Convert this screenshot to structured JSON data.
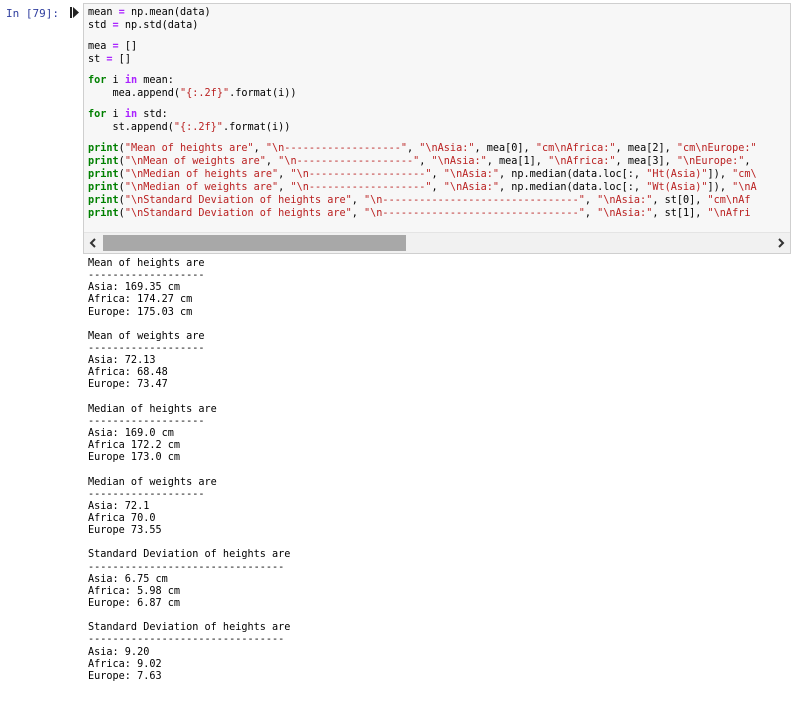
{
  "cell": {
    "prompt": "In [79]:",
    "code_lines": [
      [
        {
          "t": "mean "
        },
        {
          "t": "=",
          "c": "op"
        },
        {
          "t": " np.mean(data)"
        }
      ],
      [
        {
          "t": "std "
        },
        {
          "t": "=",
          "c": "op"
        },
        {
          "t": " np.std(data)"
        }
      ],
      [],
      [
        {
          "t": "mea "
        },
        {
          "t": "=",
          "c": "op"
        },
        {
          "t": " []"
        }
      ],
      [
        {
          "t": "st "
        },
        {
          "t": "=",
          "c": "op"
        },
        {
          "t": " []"
        }
      ],
      [],
      [
        {
          "t": "for",
          "c": "kw"
        },
        {
          "t": " i "
        },
        {
          "t": "in",
          "c": "op"
        },
        {
          "t": " mean:"
        }
      ],
      [
        {
          "t": "    mea.append("
        },
        {
          "t": "\"{:.2f}\"",
          "c": "str"
        },
        {
          "t": ".format(i))"
        }
      ],
      [],
      [
        {
          "t": "for",
          "c": "kw"
        },
        {
          "t": " i "
        },
        {
          "t": "in",
          "c": "op"
        },
        {
          "t": " std:"
        }
      ],
      [
        {
          "t": "    st.append("
        },
        {
          "t": "\"{:.2f}\"",
          "c": "str"
        },
        {
          "t": ".format(i))"
        }
      ],
      [],
      [
        {
          "t": "print",
          "c": "kw"
        },
        {
          "t": "("
        },
        {
          "t": "\"Mean of heights are\"",
          "c": "str"
        },
        {
          "t": ", "
        },
        {
          "t": "\"\\n-------------------\"",
          "c": "str"
        },
        {
          "t": ", "
        },
        {
          "t": "\"\\nAsia:\"",
          "c": "str"
        },
        {
          "t": ", mea[0], "
        },
        {
          "t": "\"cm\\nAfrica:\"",
          "c": "str"
        },
        {
          "t": ", mea[2], "
        },
        {
          "t": "\"cm\\nEurope:\"",
          "c": "str"
        }
      ],
      [
        {
          "t": "print",
          "c": "kw"
        },
        {
          "t": "("
        },
        {
          "t": "\"\\nMean of weights are\"",
          "c": "str"
        },
        {
          "t": ", "
        },
        {
          "t": "\"\\n-------------------\"",
          "c": "str"
        },
        {
          "t": ", "
        },
        {
          "t": "\"\\nAsia:\"",
          "c": "str"
        },
        {
          "t": ", mea[1], "
        },
        {
          "t": "\"\\nAfrica:\"",
          "c": "str"
        },
        {
          "t": ", mea[3], "
        },
        {
          "t": "\"\\nEurope:\"",
          "c": "str"
        },
        {
          "t": ","
        }
      ],
      [
        {
          "t": "print",
          "c": "kw"
        },
        {
          "t": "("
        },
        {
          "t": "\"\\nMedian of heights are\"",
          "c": "str"
        },
        {
          "t": ", "
        },
        {
          "t": "\"\\n-------------------\"",
          "c": "str"
        },
        {
          "t": ", "
        },
        {
          "t": "\"\\nAsia:\"",
          "c": "str"
        },
        {
          "t": ", np.median(data.loc[:, "
        },
        {
          "t": "\"Ht(Asia)\"",
          "c": "str"
        },
        {
          "t": "]), "
        },
        {
          "t": "\"cm\\",
          "c": "str"
        }
      ],
      [
        {
          "t": "print",
          "c": "kw"
        },
        {
          "t": "("
        },
        {
          "t": "\"\\nMedian of weights are\"",
          "c": "str"
        },
        {
          "t": ", "
        },
        {
          "t": "\"\\n-------------------\"",
          "c": "str"
        },
        {
          "t": ", "
        },
        {
          "t": "\"\\nAsia:\"",
          "c": "str"
        },
        {
          "t": ", np.median(data.loc[:, "
        },
        {
          "t": "\"Wt(Asia)\"",
          "c": "str"
        },
        {
          "t": "]), "
        },
        {
          "t": "\"\\nA",
          "c": "str"
        }
      ],
      [
        {
          "t": "print",
          "c": "kw"
        },
        {
          "t": "("
        },
        {
          "t": "\"\\nStandard Deviation of heights are\"",
          "c": "str"
        },
        {
          "t": ", "
        },
        {
          "t": "\"\\n--------------------------------\"",
          "c": "str"
        },
        {
          "t": ", "
        },
        {
          "t": "\"\\nAsia:\"",
          "c": "str"
        },
        {
          "t": ", st[0], "
        },
        {
          "t": "\"cm\\nAf",
          "c": "str"
        }
      ],
      [
        {
          "t": "print",
          "c": "kw"
        },
        {
          "t": "("
        },
        {
          "t": "\"\\nStandard Deviation of heights are\"",
          "c": "str"
        },
        {
          "t": ", "
        },
        {
          "t": "\"\\n--------------------------------\"",
          "c": "str"
        },
        {
          "t": ", "
        },
        {
          "t": "\"\\nAsia:\"",
          "c": "str"
        },
        {
          "t": ", st[1], "
        },
        {
          "t": "\"\\nAfri",
          "c": "str"
        }
      ]
    ]
  },
  "scrollbar": {
    "left_arrow": "<",
    "right_arrow": ">"
  },
  "output_lines": [
    "Mean of heights are",
    "-------------------",
    "Asia: 169.35 cm",
    "Africa: 174.27 cm",
    "Europe: 175.03 cm",
    "",
    "Mean of weights are",
    "-------------------",
    "Asia: 72.13",
    "Africa: 68.48",
    "Europe: 73.47",
    "",
    "Median of heights are",
    "-------------------",
    "Asia: 169.0 cm",
    "Africa 172.2 cm",
    "Europe 173.0 cm",
    "",
    "Median of weights are",
    "-------------------",
    "Asia: 72.1",
    "Africa 70.0",
    "Europe 73.55",
    "",
    "Standard Deviation of heights are",
    "--------------------------------",
    "Asia: 6.75 cm",
    "Africa: 5.98 cm",
    "Europe: 6.87 cm",
    "",
    "Standard Deviation of heights are",
    "--------------------------------",
    "Asia: 9.20",
    "Africa: 9.02",
    "Europe: 7.63"
  ],
  "colors": {
    "prompt": "#303f9f",
    "keyword": "#008000",
    "operator": "#aa22ff",
    "string": "#ba2121",
    "cell_bg": "#f7f7f7"
  }
}
